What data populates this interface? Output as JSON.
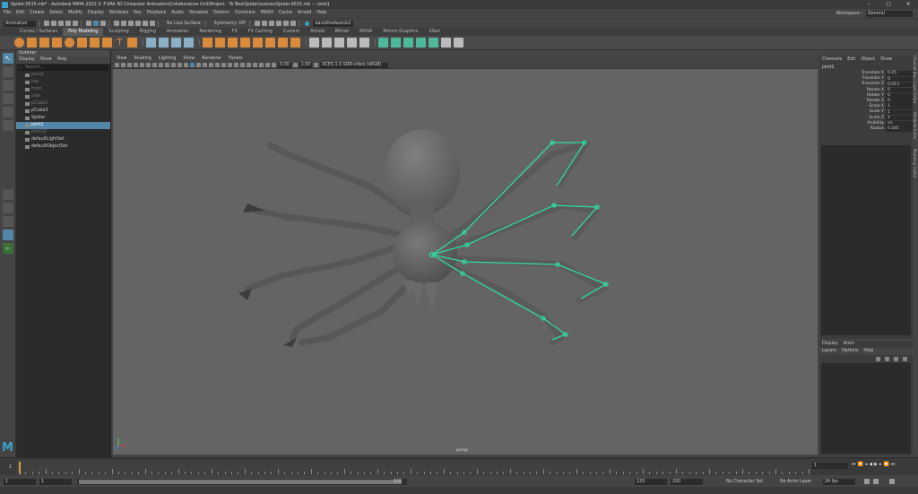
{
  "title_bar": {
    "title": "Spider.0015.mb* - Autodesk MAYA 2022.3: F:\\MA 3D Computer Animation\\Collaborative Unit\\Project - To Bee\\Spider\\scenes\\Spider.0015.mb  ---  joint1",
    "minimize": "–",
    "maximize": "□",
    "close": "✕"
  },
  "menu": [
    "File",
    "Edit",
    "Create",
    "Select",
    "Modify",
    "Display",
    "Windows",
    "Key",
    "Playback",
    "Audio",
    "Visualize",
    "Deform",
    "Constrain",
    "MASH",
    "Cache",
    "Arnold",
    "Help"
  ],
  "workspace": {
    "label": "Workspace :",
    "value": "General"
  },
  "status_line": {
    "mode": "Animation",
    "surface": "No Live Surface",
    "symmetry": "Symmetry: Off",
    "user": "davidfredwards2"
  },
  "shelf_tabs": [
    "Curves / Surfaces",
    "Poly Modeling",
    "Sculpting",
    "Rigging",
    "Animation",
    "Rendering",
    "FX",
    "FX Caching",
    "Custom",
    "Arnold",
    "Bifrost",
    "MASH",
    "Motion Graphics",
    "XGen"
  ],
  "shelf_active": "Poly Modeling",
  "outliner": {
    "title": "Outliner",
    "menu": [
      "Display",
      "Show",
      "Help"
    ],
    "search_placeholder": "Search...",
    "rows": [
      {
        "label": "persp",
        "dim": true,
        "sel": false
      },
      {
        "label": "top",
        "dim": true,
        "sel": false
      },
      {
        "label": "front",
        "dim": true,
        "sel": false
      },
      {
        "label": "side",
        "dim": true,
        "sel": false
      },
      {
        "label": "pCube1",
        "dim": true,
        "sel": false
      },
      {
        "label": "pCube3",
        "dim": false,
        "sel": false
      },
      {
        "label": "Spider",
        "dim": false,
        "sel": false
      },
      {
        "label": "joint1",
        "dim": false,
        "sel": true
      },
      {
        "label": "joint10",
        "dim": true,
        "sel": false
      },
      {
        "label": "defaultLightSet",
        "dim": false,
        "sel": false
      },
      {
        "label": "defaultObjectSet",
        "dim": false,
        "sel": false
      }
    ]
  },
  "viewport": {
    "menu": [
      "View",
      "Shading",
      "Lighting",
      "Show",
      "Renderer",
      "Panels"
    ],
    "field_a": "0.00",
    "field_b": "1.00",
    "color_space": "ACES 1.0 SDR-video (sRGB)",
    "camera_label": "persp"
  },
  "channel_box": {
    "menu": [
      "Channels",
      "Edit",
      "Object",
      "Show"
    ],
    "object": "joint1",
    "attributes": [
      {
        "name": "Translate X",
        "value": "0.25"
      },
      {
        "name": "Translate Y",
        "value": "0"
      },
      {
        "name": "Translate Z",
        "value": "0.013"
      },
      {
        "name": "Rotate X",
        "value": "0"
      },
      {
        "name": "Rotate Y",
        "value": "0"
      },
      {
        "name": "Rotate Z",
        "value": "0"
      },
      {
        "name": "Scale X",
        "value": "1"
      },
      {
        "name": "Scale Y",
        "value": "1"
      },
      {
        "name": "Scale Z",
        "value": "1"
      },
      {
        "name": "Visibility",
        "value": "on"
      },
      {
        "name": "Radius",
        "value": "0.181"
      }
    ]
  },
  "side_tabs": [
    "Channel Box / Layer Editor",
    "Attribute Editor",
    "Modeling Toolkit"
  ],
  "layer_editor": {
    "tabs": [
      "Display",
      "Anim"
    ],
    "menu": [
      "Layers",
      "Options",
      "Help"
    ]
  },
  "timeline": {
    "current_frame": "1",
    "start": "1",
    "playback_start": "1",
    "range_end_label": "120",
    "end": "120",
    "anim_end": "200"
  },
  "range_bar": {
    "character_set": "No Character Set",
    "anim_layer": "No Anim Layer",
    "fps": "24 fps"
  },
  "logo_text": "M",
  "colors": {
    "selection": "#5285a6",
    "joint": "#2fdc9e",
    "viewport_bg": "#646464"
  }
}
